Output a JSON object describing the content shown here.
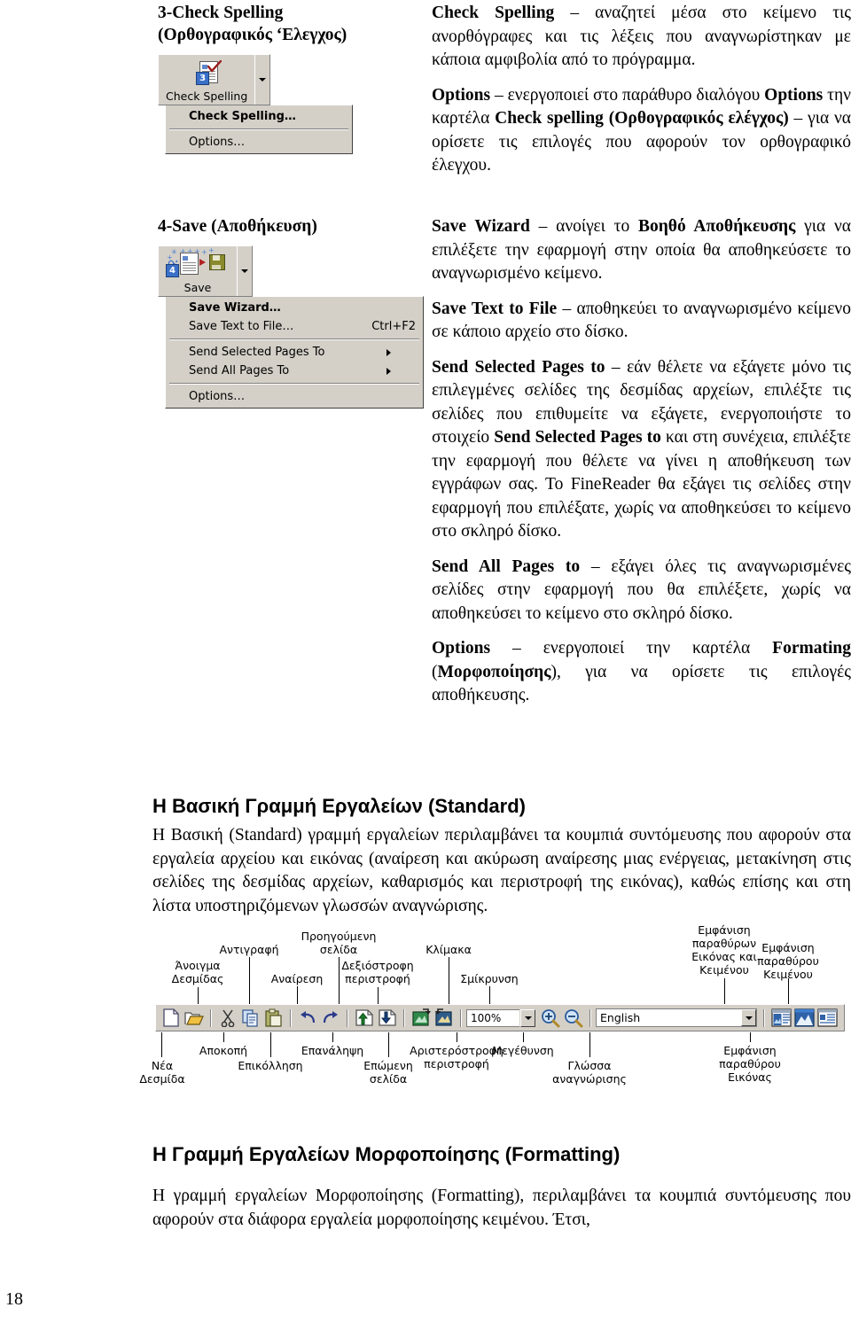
{
  "page": {
    "number": "18"
  },
  "sections": [
    {
      "heading_line1": "3-Check Spelling",
      "heading_line2": "(Ορθογραφικός ‘Ελεγχος)",
      "toolbutton": {
        "label": "Check Spelling",
        "badge": "3"
      },
      "menu_items": [
        {
          "label": "Check Spelling…",
          "accel": "",
          "bold": true,
          "submenu": false
        },
        {
          "sep": true
        },
        {
          "label": "Options…",
          "accel": "",
          "bold": false,
          "submenu": false
        }
      ],
      "paragraphs": [
        [
          {
            "t": "Check Spelling",
            "b": true
          },
          {
            "t": " – αναζητεί μέσα στο κείμενο τις ανορθόγραφες και τις λέξεις που αναγνωρίστηκαν με κάποια αμφιβολία από το πρόγραμμα.",
            "b": false
          }
        ],
        [
          {
            "t": "Options",
            "b": true
          },
          {
            "t": " – ενεργοποιεί στο παράθυρο διαλόγου ",
            "b": false
          },
          {
            "t": "Options",
            "b": true
          },
          {
            "t": " την καρτέλα ",
            "b": false
          },
          {
            "t": "Check spelling (Ορθογραφικός ελέγχος)",
            "b": true
          },
          {
            "t": " – για να ορίσετε τις επιλογές που αφορούν τον ορθογραφικό έλεγχου.",
            "b": false
          }
        ]
      ]
    },
    {
      "heading_line1": "4-Save (Αποθήκευση)",
      "heading_line2": "",
      "toolbutton": {
        "label": "Save",
        "badge": "4"
      },
      "menu_items": [
        {
          "label": "Save Wizard…",
          "accel": "",
          "bold": true,
          "submenu": false
        },
        {
          "label": "Save Text to File…",
          "accel": "Ctrl+F2",
          "bold": false,
          "submenu": false
        },
        {
          "sep": true
        },
        {
          "label": "Send Selected Pages To",
          "accel": "",
          "bold": false,
          "submenu": true
        },
        {
          "label": "Send All Pages To",
          "accel": "",
          "bold": false,
          "submenu": true
        },
        {
          "sep": true
        },
        {
          "label": "Options…",
          "accel": "",
          "bold": false,
          "submenu": false
        }
      ],
      "paragraphs": [
        [
          {
            "t": "Save Wizard",
            "b": true
          },
          {
            "t": " – ανοίγει το ",
            "b": false
          },
          {
            "t": "Βοηθό Αποθήκευσης",
            "b": true
          },
          {
            "t": " για να επιλέξετε την εφαρμογή στην οποία θα αποθηκεύσετε το αναγνωρισμένο κείμενο.",
            "b": false
          }
        ],
        [
          {
            "t": "Save Text to File",
            "b": true
          },
          {
            "t": " – αποθηκεύει το αναγνωρισμένο κείμενο σε κάποιο αρχείο στο δίσκο.",
            "b": false
          }
        ],
        [
          {
            "t": "Send Selected Pages to",
            "b": true
          },
          {
            "t": " – εάν θέλετε να εξάγετε μόνο τις επιλεγμένες σελίδες της δεσμίδας αρχείων, επιλέξτε τις σελίδες που επιθυμείτε να εξάγετε, ενεργοποιήστε το στοιχείο ",
            "b": false
          },
          {
            "t": "Send Selected Pages to",
            "b": true
          },
          {
            "t": " και στη συνέχεια, επιλέξτε την εφαρμογή που θέλετε να γίνει η αποθήκευση των εγγράφων σας. Το FineReader θα εξάγει τις σελίδες στην εφαρμογή που επιλέξατε, χωρίς να αποθηκεύσει το κείμενο στο σκληρό δίσκο.",
            "b": false
          }
        ],
        [
          {
            "t": "Send All Pages to",
            "b": true
          },
          {
            "t": " – εξάγει όλες τις αναγνωρισμένες σελίδες στην εφαρμογή που θα επιλέξετε, χωρίς να αποθηκεύσει το κείμενο στο σκληρό δίσκο.",
            "b": false
          }
        ],
        [
          {
            "t": "Options",
            "b": true
          },
          {
            "t": " – ενεργοποιεί την καρτέλα ",
            "b": false
          },
          {
            "t": "Formating",
            "b": true
          },
          {
            "t": " (",
            "b": false
          },
          {
            "t": "Μορφοποίησης",
            "b": true
          },
          {
            "t": "), για να ορίσετε τις επιλογές αποθήκευσης.",
            "b": false
          }
        ]
      ]
    }
  ],
  "standard_toolbar": {
    "heading": "Η Βασική Γραμμή Εργαλείων (Standard)",
    "paragraph": "Η Βασική (Standard) γραμμή εργαλείων περιλαμβάνει τα κουμπιά συντόμευσης που αφορούν στα εργαλεία αρχείου και εικόνας (αναίρεση και ακύρωση αναίρεσης μιας ενέργειας, μετακίνηση στις σελίδες της δεσμίδας αρχείων, καθαρισμός και περιστροφή της εικόνας), καθώς επίσης και στη λίστα υποστηριζόμενων γλωσσών αναγνώρισης.",
    "zoom_value": "100%",
    "language_value": "English",
    "labels_above": [
      {
        "text": "Άνοιγμα\nΔεσμίδας"
      },
      {
        "text": "Αντιγραφή"
      },
      {
        "text": "Αναίρεση"
      },
      {
        "text": "Προηγούμενη\nσελίδα"
      },
      {
        "text": "Δεξιόστροφη\nπεριστροφή"
      },
      {
        "text": "Κλίμακα"
      },
      {
        "text": "Σμίκρυνση"
      },
      {
        "text": "Εμφάνιση\nπαραθύρων\nΕικόνας και\nΚειμένου"
      },
      {
        "text": "Εμφάνιση\nπαραθύρου\nΚειμένου"
      }
    ],
    "labels_below": [
      {
        "text": "Νέα\nΔεσμίδα"
      },
      {
        "text": "Αποκοπή"
      },
      {
        "text": "Επικόλληση"
      },
      {
        "text": "Επανάληψη"
      },
      {
        "text": "Επώμενη\nσελίδα"
      },
      {
        "text": "Αριστερόστροφη\nπεριστροφή"
      },
      {
        "text": "Μεγέθυνση"
      },
      {
        "text": "Γλώσσα\nαναγνώρισης"
      },
      {
        "text": "Εμφάνιση\nπαραθύρου\nΕικόνας"
      }
    ]
  },
  "formatting_toolbar": {
    "heading": "Η Γραμμή Εργαλείων Μορφοποίησης (Formatting)",
    "paragraph": "Η γραμμή εργαλείων Μορφοποίησης (Formatting), περιλαμβάνει τα κουμπιά συντόμευσης που αφορούν στα διάφορα εργαλεία μορφοποίησης κειμένου. Έτσι,"
  }
}
